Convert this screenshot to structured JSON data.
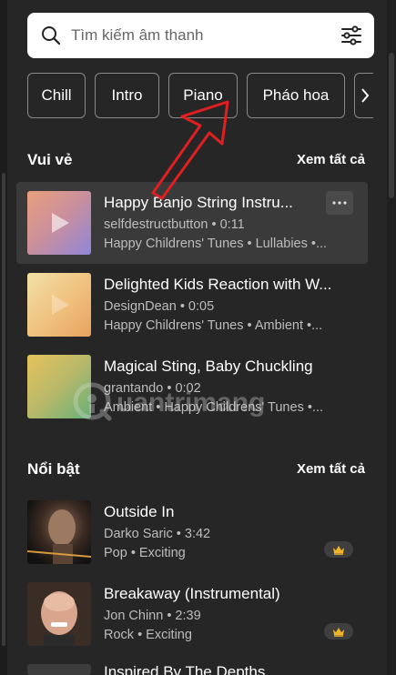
{
  "search": {
    "placeholder": "Tìm kiếm âm thanh",
    "value": ""
  },
  "chips": [
    "Chill",
    "Intro",
    "Piano",
    "Pháo hoa"
  ],
  "sections": [
    {
      "title": "Vui vẻ",
      "see_all": "Xem tất cả",
      "items": [
        {
          "title": "Happy Banjo String Instru...",
          "author_duration": "selfdestructbutton • 0:11",
          "tags": "Happy Childrens' Tunes • Lullabies •...",
          "thumb_colors": [
            "#e9a07c",
            "#8f86d9"
          ]
        },
        {
          "title": "Delighted Kids Reaction with W...",
          "author_duration": "DesignDean • 0:05",
          "tags": "Happy Childrens' Tunes • Ambient •...",
          "thumb_colors": [
            "#f2e1a6",
            "#e8a35e"
          ]
        },
        {
          "title": "Magical Sting, Baby Chuckling",
          "author_duration": "grantando • 0:02",
          "tags": "Ambient • Happy Childrens' Tunes •...",
          "thumb_colors": [
            "#e6c25c",
            "#63b277"
          ]
        }
      ]
    },
    {
      "title": "Nổi bật",
      "see_all": "Xem tất cả",
      "items": [
        {
          "title": "Outside In",
          "author_duration": "Darko Saric • 3:42",
          "tags": "Pop • Exciting"
        },
        {
          "title": "Breakaway (Instrumental)",
          "author_duration": "Jon Chinn • 2:39",
          "tags": "Rock • Exciting"
        },
        {
          "title": "Inspired By The Depths",
          "author_duration": "",
          "tags": ""
        }
      ]
    }
  ],
  "watermark": "uantrimang",
  "colors": {
    "background": "#262626",
    "hover_row": "#3a3a3a",
    "crown": "#f0b429",
    "annotation_arrow": "#e02020"
  }
}
